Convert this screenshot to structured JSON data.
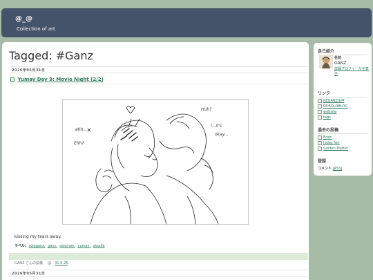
{
  "header": {
    "title": "@_@",
    "description": "Collection of art"
  },
  "main": {
    "heading": "Tagged: #Ganz",
    "posts": [
      {
        "date": "2026年05月31日",
        "title": "Yumay Day 9: Movie Night (2/2)",
        "caption": "kissing my tears away.",
        "labels_prefix": "ラベル:",
        "labels": [
          "sologanz,",
          "ganz,",
          "solomon,",
          "yumay,",
          "doodle"
        ],
        "author_line": "GANZ さんの投稿",
        "author_sep": "@",
        "time": "31.5.26",
        "art_words": [
          "ehh...",
          "Ehh?",
          "Huh?",
          "i...it's",
          "okay..."
        ]
      },
      {
        "date": "2026年05月31日"
      }
    ]
  },
  "sidebar": {
    "profile": {
      "heading": "自己紹介",
      "name_label": "名前",
      "name": "GANZ",
      "details_link": "詳細プロフィールを表示"
    },
    "links": {
      "heading": "リンク",
      "items": [
        "REGANZIUM",
        "DDSOLOBLOG",
        "website",
        "tags"
      ]
    },
    "archive": {
      "heading": "過去の投稿",
      "items": [
        "Eden",
        "Judas No!",
        "Golden Platter"
      ]
    },
    "subscribe": {
      "heading": "登録",
      "comments_label": "コメント",
      "rss": "[RSS]"
    }
  },
  "colors": {
    "background": "#a6bca6",
    "header": "#44526a",
    "link": "#2a7a5a",
    "footer_bar": "#dcecd8"
  }
}
